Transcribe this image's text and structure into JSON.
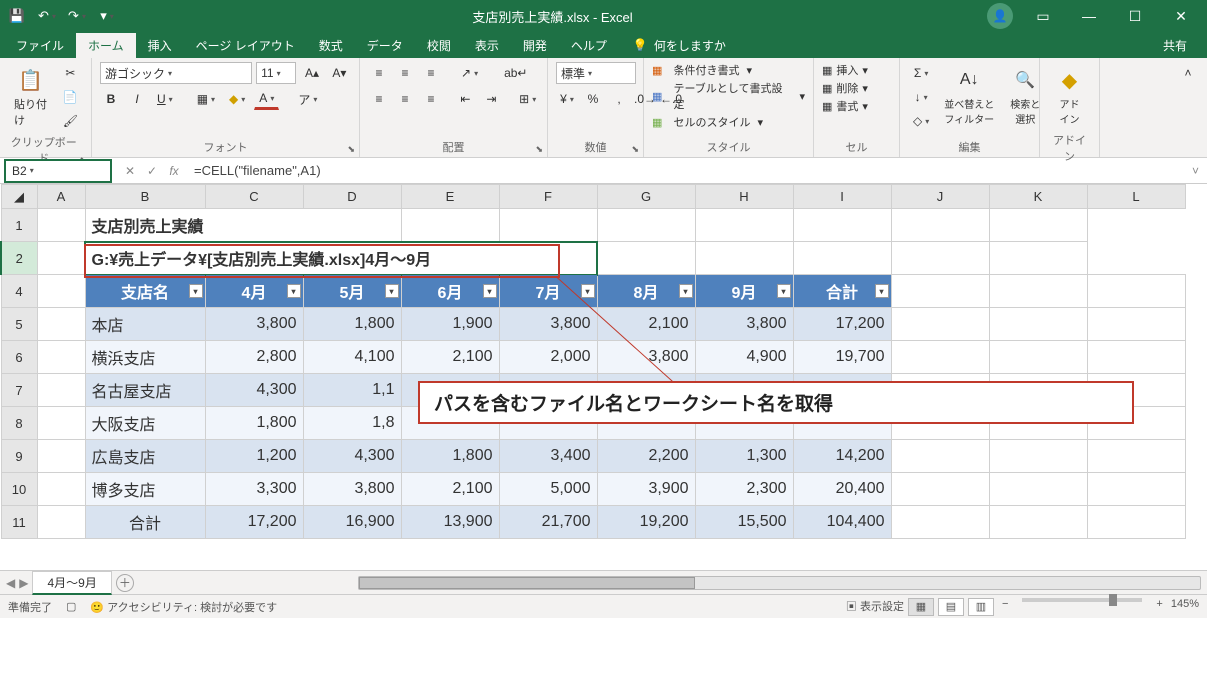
{
  "title": "支店別売上実績.xlsx  -  Excel",
  "qat": {
    "save": "💾",
    "undo": "↶",
    "redo": "↷"
  },
  "tabs": [
    "ファイル",
    "ホーム",
    "挿入",
    "ページ レイアウト",
    "数式",
    "データ",
    "校閲",
    "表示",
    "開発",
    "ヘルプ"
  ],
  "tellme": {
    "icon": "💡",
    "placeholder": "何をしますか"
  },
  "share": "共有",
  "ribbon": {
    "clipboard": {
      "paste": "貼り付け",
      "label": "クリップボード"
    },
    "font": {
      "name": "游ゴシック",
      "size": "11",
      "label": "フォント"
    },
    "alignment": {
      "wrap": "㍿",
      "label": "配置"
    },
    "number": {
      "format": "標準",
      "label": "数値"
    },
    "styles": {
      "cond": "条件付き書式",
      "table": "テーブルとして書式設定",
      "cell": "セルのスタイル",
      "label": "スタイル"
    },
    "cells": {
      "insert": "挿入",
      "delete": "削除",
      "format": "書式",
      "label": "セル"
    },
    "editing": {
      "sort": "並べ替えと\nフィルター",
      "find": "検索と\n選択",
      "label": "編集"
    },
    "addin": {
      "btn": "アド\nイン",
      "label": "アドイン"
    }
  },
  "namebox": "B2",
  "formula": "=CELL(\"filename\",A1)",
  "columns": [
    "",
    "A",
    "B",
    "C",
    "D",
    "E",
    "F",
    "G",
    "H",
    "I",
    "J",
    "K",
    "L"
  ],
  "rows": [
    "1",
    "2",
    "4",
    "5",
    "6",
    "7",
    "8",
    "9",
    "10",
    "11"
  ],
  "sheetTitle": "支店別売上実績",
  "cellPath": "G:¥売上データ¥[支店別売上実績.xlsx]4月～9月",
  "chart_data": {
    "type": "table",
    "headers": [
      "支店名",
      "4月",
      "5月",
      "6月",
      "7月",
      "8月",
      "9月",
      "合計"
    ],
    "rows": [
      [
        "本店",
        "3,800",
        "1,800",
        "1,900",
        "3,800",
        "2,100",
        "3,800",
        "17,200"
      ],
      [
        "横浜支店",
        "2,800",
        "4,100",
        "2,100",
        "2,000",
        "3,800",
        "4,900",
        "19,700"
      ],
      [
        "名古屋支店",
        "4,300",
        "1,1",
        "",
        "",
        "",
        "",
        ""
      ],
      [
        "大阪支店",
        "1,800",
        "1,8",
        "",
        "",
        "",
        "",
        ""
      ],
      [
        "広島支店",
        "1,200",
        "4,300",
        "1,800",
        "3,400",
        "2,200",
        "1,300",
        "14,200"
      ],
      [
        "博多支店",
        "3,300",
        "3,800",
        "2,100",
        "5,000",
        "3,900",
        "2,300",
        "20,400"
      ],
      [
        "合計",
        "17,200",
        "16,900",
        "13,900",
        "21,700",
        "19,200",
        "15,500",
        "104,400"
      ]
    ]
  },
  "annotation": "パスを含むファイル名とワークシート名を取得",
  "sheetTab": "4月～9月",
  "status": {
    "ready": "準備完了",
    "recording": "",
    "acc": "アクセシビリティ: 検討が必要です",
    "display": "表示設定",
    "zoom": "145%"
  }
}
